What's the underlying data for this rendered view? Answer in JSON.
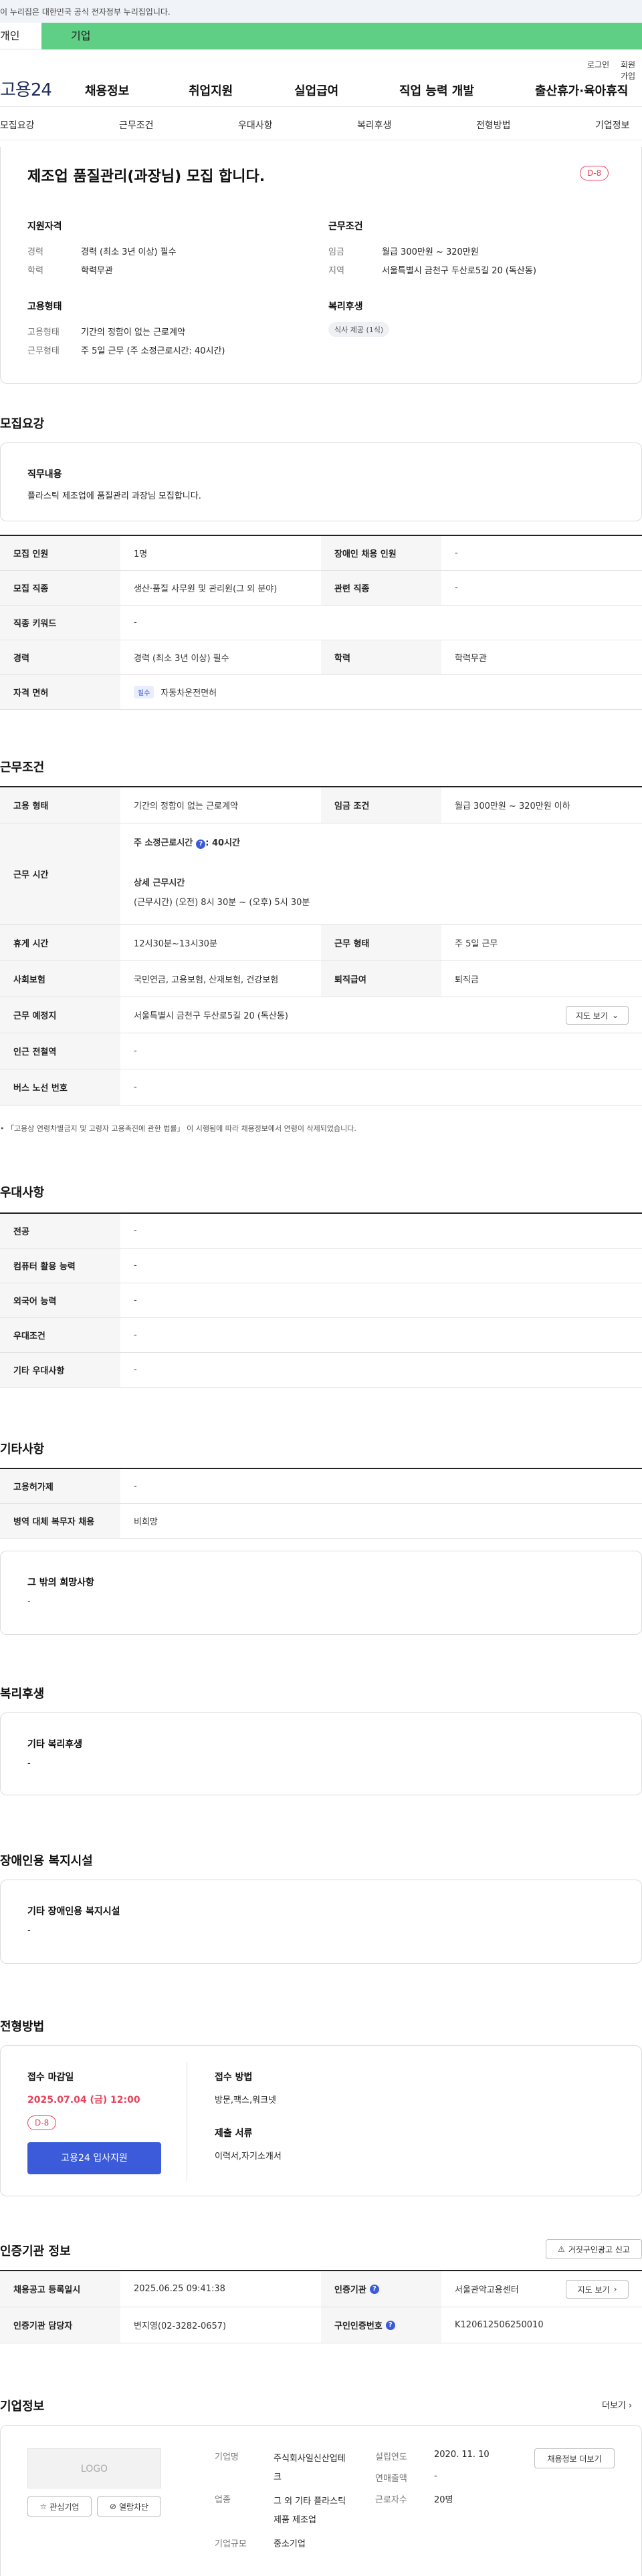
{
  "gov_banner": "이 누리집은 대한민국 공식 전자정부 누리집입니다.",
  "user_tabs": {
    "individual": "개인",
    "business": "기업"
  },
  "util": {
    "login": "로그인",
    "join": "회원가입"
  },
  "logo": "고용24",
  "gnb": [
    "채용정보",
    "취업지원",
    "실업급여",
    "직업 능력 개발",
    "출산휴가·육아휴직"
  ],
  "subnav": [
    "모집요강",
    "근무조건",
    "우대사항",
    "복리후생",
    "전형방법",
    "기업정보"
  ],
  "summary": {
    "title": "제조업 품질관리(과장님) 모집 합니다.",
    "dday": "D-8",
    "qual_h": "지원자격",
    "career_l": "경력",
    "career_v": "경력 (최소 3년 이상) 필수",
    "edu_l": "학력",
    "edu_v": "학력무관",
    "cond_h": "근무조건",
    "wage_l": "임금",
    "wage_v": "월급 300만원 ~ 320만원",
    "region_l": "지역",
    "region_v": "서울특별시 금천구 두산로5길 20 (독산동)",
    "emp_h": "고용형태",
    "emptype_l": "고용형태",
    "emptype_v": "기간의 정함이 없는 근로계약",
    "worktype_l": "근무형태",
    "worktype_v": "주 5일 근무 (주 소정근로시간: 40시간)",
    "welfare_h": "복리후생",
    "welfare_chip": "식사 제공 (1식)"
  },
  "recruit": {
    "heading": "모집요강",
    "job_h": "직무내용",
    "job_v": "플라스틱 제조업에 품질관리 과장님 모집합니다.",
    "rows": [
      [
        "모집 인원",
        "1명",
        "장애인 채용 인원",
        "-"
      ],
      [
        "모집 직종",
        "생산·품질 사무원 및 관리원(그 외 분야)",
        "관련 직종",
        "-"
      ],
      [
        "직종 키워드",
        "-"
      ],
      [
        "경력",
        "경력 (최소 3년 이상) 필수",
        "학력",
        "학력무관"
      ],
      [
        "자격 면허",
        "자동차운전면허"
      ]
    ],
    "required_tag": "필수"
  },
  "conditions": {
    "heading": "근무조건",
    "emp_l": "고용 형태",
    "emp_v": "기간의 정함이 없는 근로계약",
    "wage_l": "임금 조건",
    "wage_v": "월급 300만원 ~ 320만원 이하",
    "hours_l": "근무 시간",
    "weekly": "주 소정근로시간",
    "weekly_v": ": 40시간",
    "detail_h": "상세 근무시간",
    "detail_v": "(근무시간) (오전) 8시 30분 ~ (오후) 5시 30분",
    "break_l": "휴게 시간",
    "break_v": "12시30분~13시30분",
    "form_l": "근무 형태",
    "form_v": "주 5일 근무",
    "ins_l": "사회보험",
    "ins_v": "국민연금, 고용보험, 산재보험, 건강보험",
    "retire_l": "퇴직급여",
    "retire_v": "퇴직금",
    "place_l": "근무 예정지",
    "place_v": "서울특별시 금천구 두산로5길 20 (독산동)",
    "map_btn": "지도 보기",
    "subway_l": "인근 전철역",
    "subway_v": "-",
    "bus_l": "버스 노선 번호",
    "bus_v": "-",
    "note": "「고용상 연령차별금지 및 고령자 고용촉진에 관한 법률」 이 시행됨에 따라 채용정보에서 연령이 삭제되었습니다."
  },
  "pref": {
    "heading": "우대사항",
    "rows": [
      [
        "전공",
        "-"
      ],
      [
        "컴퓨터 활용 능력",
        "-"
      ],
      [
        "외국어 능력",
        "-"
      ],
      [
        "우대조건",
        "-"
      ],
      [
        "기타 우대사항",
        "-"
      ]
    ]
  },
  "etc": {
    "heading": "기타사항",
    "rows": [
      [
        "고용허가제",
        "-"
      ],
      [
        "병역 대체 복무자 채용",
        "비희망"
      ]
    ],
    "other_h": "그 밖의 희망사항",
    "other_v": "-"
  },
  "welfare": {
    "heading": "복리후생",
    "box_h": "기타 복리후생",
    "box_v": "-"
  },
  "disabled": {
    "heading": "장애인용 복지시설",
    "box_h": "기타 장애인용 복지시설",
    "box_v": "-"
  },
  "screening": {
    "heading": "전형방법",
    "deadline_h": "접수 마감일",
    "deadline_v": "2025.07.04 (금) 12:00",
    "dday": "D-8",
    "apply_btn": "고용24 입사지원",
    "method_h": "접수 방법",
    "method_v": "방문,팩스,워크넷",
    "docs_h": "제출 서류",
    "docs_v": "이력서,자기소개서"
  },
  "cert": {
    "heading": "인증기관 정보",
    "report_btn": "거짓구인광고 신고",
    "reg_l": "채용공고 등록일시",
    "reg_v": "2025.06.25 09:41:38",
    "org_l": "인증기관",
    "org_v": "서울관악고용센터",
    "map_btn": "지도 보기",
    "mgr_l": "인증기관 담당자",
    "mgr_v": "변지영(02-3282-0657)",
    "no_l": "구인인증번호",
    "no_v": "K120612506250010"
  },
  "company": {
    "heading": "기업정보",
    "more": "더보기",
    "logo_text": "LOGO",
    "fav_btn": "관심기업",
    "block_btn": "열람차단",
    "name_l": "기업명",
    "name_v": "주식회사일신산업테크",
    "ind_l": "업종",
    "ind_v": "그 외 기타 플라스틱 제품 제조업",
    "size_l": "기업규모",
    "size_v": "중소기업",
    "est_l": "설립연도",
    "est_v": "2020. 11. 10",
    "sales_l": "연매출액",
    "sales_v": "-",
    "emp_l": "근로자수",
    "emp_v": "20명",
    "jobs_btn": "채용정보 더보기"
  },
  "colors": {
    "accent": "#3b5bdb",
    "green": "#5fcf86",
    "red": "#e8425a"
  }
}
